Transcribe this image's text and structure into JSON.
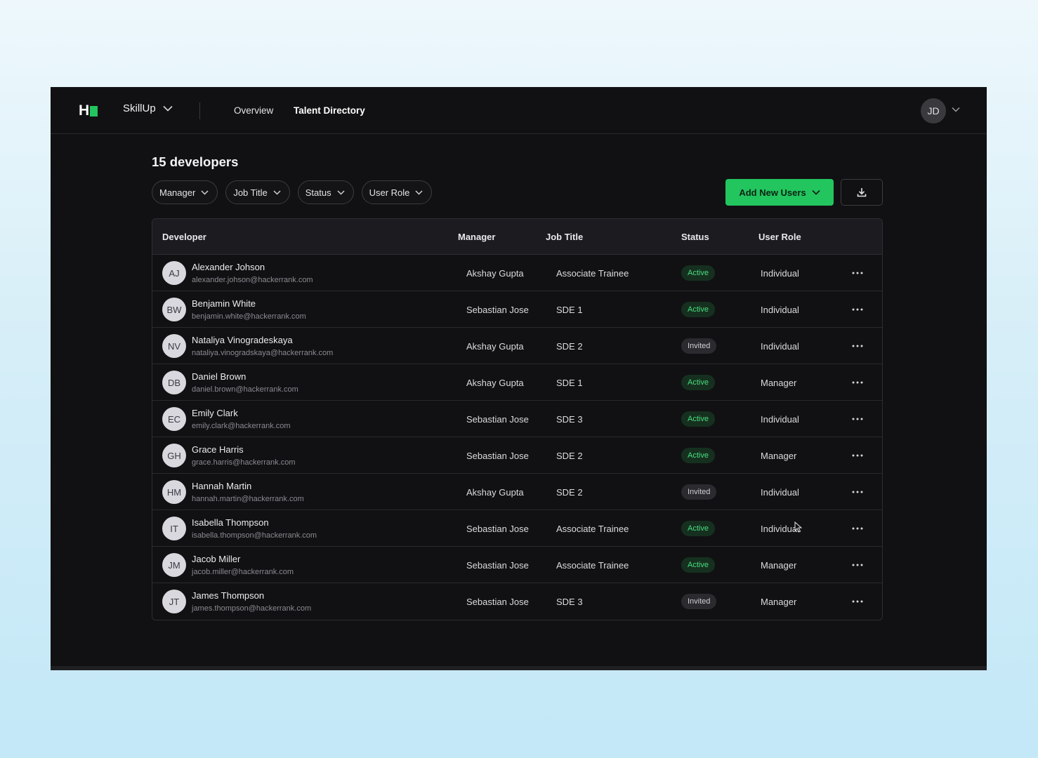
{
  "colors": {
    "accent": "#22c55e",
    "app_bg": "#111113",
    "active_text": "#4ade80"
  },
  "nav": {
    "logo_letter": "H",
    "product": "SkillUp",
    "links": [
      "Overview",
      "Talent Directory"
    ],
    "user_initials": "JD"
  },
  "main": {
    "heading": "15 developers",
    "filters": [
      "Manager",
      "Job Title",
      "Status",
      "User Role"
    ],
    "add_button": "Add New Users",
    "download_icon": "download-icon"
  },
  "table": {
    "headers": [
      "Developer",
      "Manager",
      "Job Title",
      "Status",
      "User Role"
    ],
    "rows": [
      {
        "initials": "AJ",
        "name": "Alexander Johson",
        "email": "alexander.johson@hackerrank.com",
        "manager": "Akshay Gupta",
        "job": "Associate Trainee",
        "status": "Active",
        "role": "Individual"
      },
      {
        "initials": "BW",
        "name": "Benjamin White",
        "email": "benjamin.white@hackerrank.com",
        "manager": "Sebastian Jose",
        "job": "SDE 1",
        "status": "Active",
        "role": "Individual"
      },
      {
        "initials": "NV",
        "name": "Nataliya Vinogradeskaya",
        "email": "nataliya.vinogradskaya@hackerrank.com",
        "manager": "Akshay Gupta",
        "job": "SDE 2",
        "status": "Invited",
        "role": "Individual"
      },
      {
        "initials": "DB",
        "name": "Daniel Brown",
        "email": "daniel.brown@hackerrank.com",
        "manager": "Akshay Gupta",
        "job": "SDE 1",
        "status": "Active",
        "role": "Manager"
      },
      {
        "initials": "EC",
        "name": "Emily Clark",
        "email": "emily.clark@hackerrank.com",
        "manager": "Sebastian Jose",
        "job": "SDE 3",
        "status": "Active",
        "role": "Individual"
      },
      {
        "initials": "GH",
        "name": "Grace Harris",
        "email": "grace.harris@hackerrank.com",
        "manager": "Sebastian Jose",
        "job": "SDE 2",
        "status": "Active",
        "role": "Manager"
      },
      {
        "initials": "HM",
        "name": "Hannah Martin",
        "email": "hannah.martin@hackerrank.com",
        "manager": "Akshay Gupta",
        "job": "SDE 2",
        "status": "Invited",
        "role": "Individual"
      },
      {
        "initials": "IT",
        "name": "Isabella Thompson",
        "email": "isabella.thompson@hackerrank.com",
        "manager": "Sebastian Jose",
        "job": "Associate Trainee",
        "status": "Active",
        "role": "Individual"
      },
      {
        "initials": "JM",
        "name": "Jacob Miller",
        "email": "jacob.miller@hackerrank.com",
        "manager": "Sebastian Jose",
        "job": "Associate Trainee",
        "status": "Active",
        "role": "Manager"
      },
      {
        "initials": "JT",
        "name": "James Thompson",
        "email": "james.thompson@hackerrank.com",
        "manager": "Sebastian Jose",
        "job": "SDE 3",
        "status": "Invited",
        "role": "Manager"
      }
    ]
  }
}
